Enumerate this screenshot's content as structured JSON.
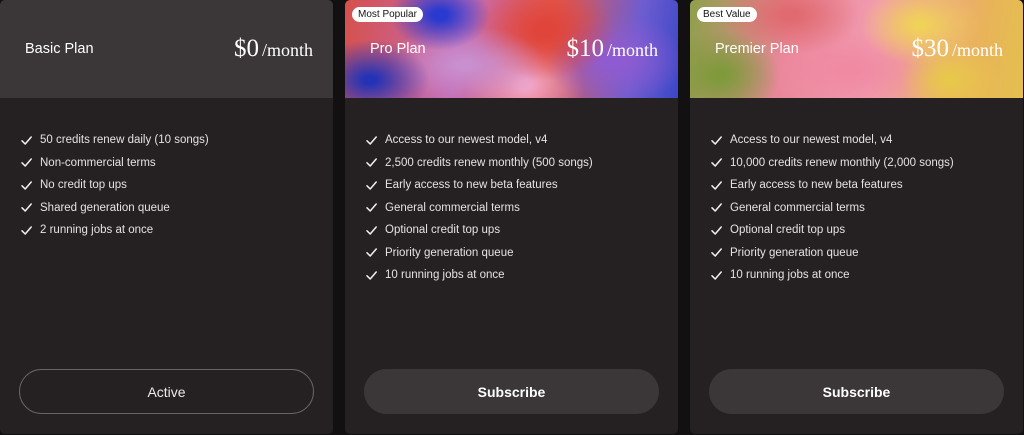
{
  "plans": [
    {
      "name": "Basic Plan",
      "price": "$0",
      "period": "/month",
      "badge": "",
      "features": [
        "50 credits renew daily (10 songs)",
        "Non-commercial terms",
        "No credit top ups",
        "Shared generation queue",
        "2 running jobs at once"
      ],
      "button": "Active"
    },
    {
      "name": "Pro Plan",
      "price": "$10",
      "period": "/month",
      "badge": "Most Popular",
      "features": [
        "Access to our newest model, v4",
        "2,500 credits renew monthly (500 songs)",
        "Early access to new beta features",
        "General commercial terms",
        "Optional credit top ups",
        "Priority generation queue",
        "10 running jobs at once"
      ],
      "button": "Subscribe"
    },
    {
      "name": "Premier Plan",
      "price": "$30",
      "period": "/month",
      "badge": "Best Value",
      "features": [
        "Access to our newest model, v4",
        "10,000 credits renew monthly (2,000 songs)",
        "Early access to new beta features",
        "General commercial terms",
        "Optional credit top ups",
        "Priority generation queue",
        "10 running jobs at once"
      ],
      "button": "Subscribe"
    }
  ],
  "icons": {
    "feature": "checkmark-icon"
  },
  "colors": {
    "card_bg": "#252122",
    "header_bg": "#3b3637",
    "button_bg": "#3b3637",
    "page_bg": "#121011"
  }
}
